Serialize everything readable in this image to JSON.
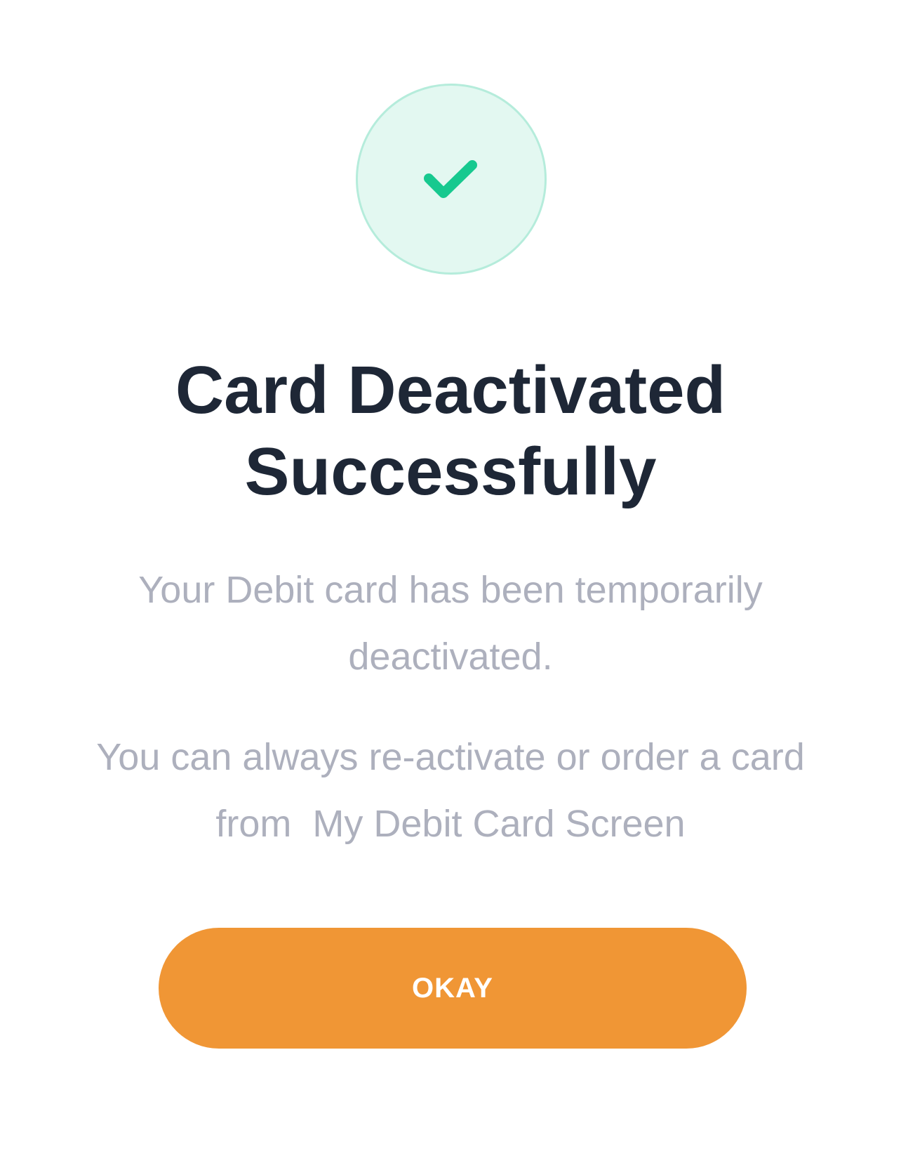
{
  "dialog": {
    "title_lines": [
      "Card Deactivated",
      "Successfully"
    ],
    "message_1_lines": [
      "Your Debit card has been temporarily",
      "deactivated."
    ],
    "message_2_lines": [
      "You can always re-activate or order a card",
      "from  My Debit Card Screen"
    ],
    "primary_button_label": "OKAY"
  },
  "icons": {
    "status_icon": "checkmark-icon"
  },
  "colors": {
    "success_green": "#17c98f",
    "success_circle_fill": "#e3f8f1",
    "success_circle_border": "#b5ecdb",
    "title_text": "#1e2736",
    "body_text": "#adb0bd",
    "button_orange": "#f09635",
    "button_text": "#ffffff"
  }
}
